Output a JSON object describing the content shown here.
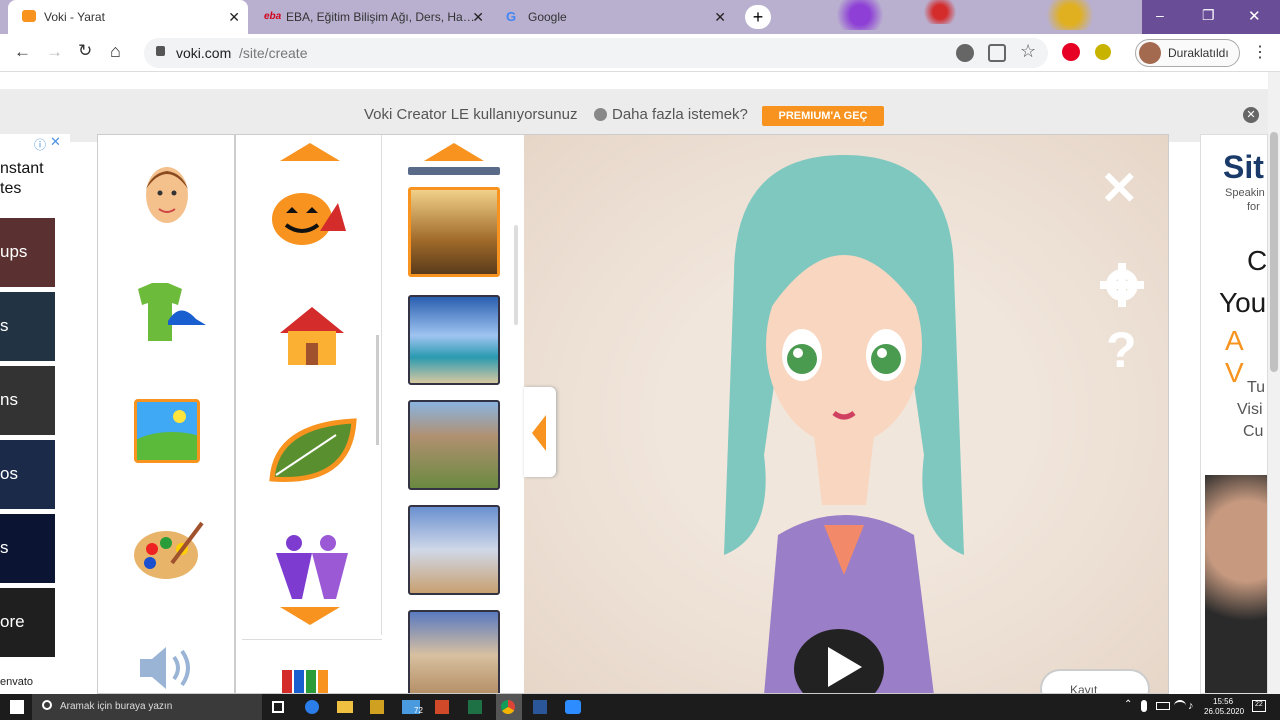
{
  "tabs": [
    {
      "title": "Voki - Yarat",
      "icon": "voki-icon"
    },
    {
      "title": "EBA, Eğitim Bilişim Ağı, Ders, Ha…",
      "icon": "eba-icon",
      "icon_text": "eba"
    },
    {
      "title": "Google",
      "icon": "google-icon",
      "icon_text": "G"
    }
  ],
  "new_tab_symbol": "+",
  "window": {
    "minimize": "–",
    "restore": "❐",
    "close": "✕"
  },
  "nav": {
    "back": "←",
    "forward": "→",
    "reload": "↻",
    "home": "⌂"
  },
  "address": {
    "host": "voki.com",
    "path": "/site/create"
  },
  "profile": {
    "label": "Duraklatıldı"
  },
  "banner": {
    "text": "Voki Creator LE kullanıyorsunuz",
    "question": "Daha fazla istemek?",
    "button": "PREMIUM'A GEÇ"
  },
  "left_ad": {
    "lines": [
      "nstant",
      "tes"
    ],
    "tiles": [
      "ups",
      "s",
      "ns",
      "os",
      "s",
      "ore"
    ],
    "brand": "envato"
  },
  "right_ad": {
    "logo": "Sit",
    "sub1": "Speakin",
    "sub2": "for",
    "l1": "C",
    "l2": "You",
    "l3": "A V",
    "l4": "Tu",
    "l5": "Visi",
    "l6": "Cu"
  },
  "categories": [
    "head-icon",
    "clothing-icon",
    "background-icon",
    "color-palette-icon",
    "speaker-icon"
  ],
  "themes": [
    "halloween-icon",
    "house-icon",
    "nature-leaf-icon",
    "people-icon",
    "books-icon"
  ],
  "backgrounds": [
    "autumn-forest",
    "beach-sky",
    "desert-mesa",
    "cactus-desert",
    "sand-dunes"
  ],
  "player": {
    "save_label": "Kayıt"
  },
  "taskbar": {
    "search": "Aramak için buraya yazın",
    "time": "15:56",
    "date": "26.05.2020",
    "badge": "72",
    "notif": "22"
  },
  "colors": {
    "accent": "#f7931e",
    "character_hair": "#7ec8c0",
    "robe": "#9a7ec7"
  }
}
